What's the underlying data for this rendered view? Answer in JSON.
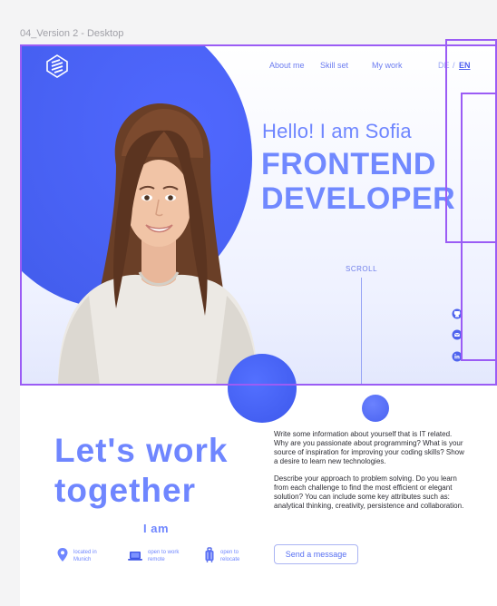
{
  "frame": {
    "title": "04_Version 2 - Desktop"
  },
  "nav": {
    "items": [
      {
        "label": "About me"
      },
      {
        "label": "Skill set"
      },
      {
        "label": "My work"
      }
    ],
    "lang_de": "DE",
    "lang_sep": "/",
    "lang_en": "EN"
  },
  "hero": {
    "greeting": "Hello! I am Sofia",
    "role_line1": "FRONTEND",
    "role_line2": "DEVELOPER",
    "scroll": "SCROLL",
    "social": [
      "github-icon",
      "mail-icon",
      "linkedin-icon"
    ]
  },
  "section": {
    "heading_line1": "Let's work",
    "heading_line2": "together",
    "iam": "I am",
    "facts": [
      {
        "icon": "location-pin-icon",
        "line1": "located in",
        "line2": "Munich"
      },
      {
        "icon": "laptop-icon",
        "line1": "open to work",
        "line2": "remote"
      },
      {
        "icon": "suitcase-icon",
        "line1": "open to",
        "line2": "relocate"
      }
    ],
    "about_p1": "Write some information about yourself that is IT related. Why are you passionate about programming? What is your source of inspiration for improving your coding skills? Show a desire to learn new technologies.",
    "about_p2": "Describe your approach to problem solving. Do you learn from each challenge to find the most efficient or elegant solution? You can include some key attributes such as: analytical thinking, creativity, persistence and collaboration.",
    "cta": "Send a message"
  },
  "colors": {
    "accent": "#6f86ff",
    "primary_blue": "#4861f3",
    "selection": "#9b5cf5"
  }
}
